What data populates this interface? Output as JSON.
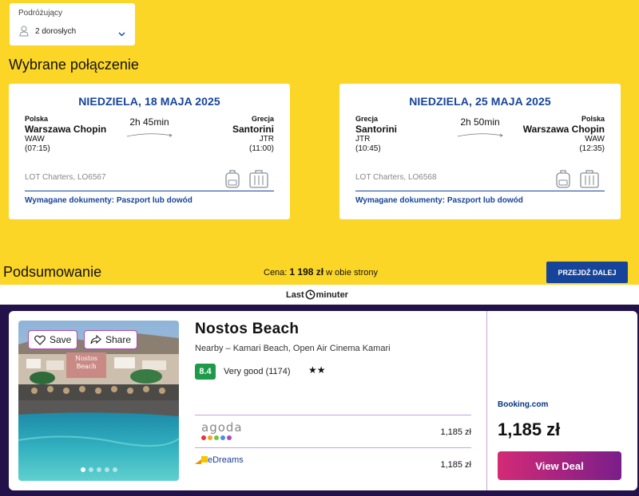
{
  "search": {
    "pax_label": "Podróżujący",
    "pax_value": "2 dorosłych"
  },
  "selected": {
    "title": "Wybrane połączenie",
    "outbound": {
      "date": "NIEDZIELA, 18 MAJA 2025",
      "from_country": "Polska",
      "from_city": "Warszawa Chopin",
      "from_code": "WAW",
      "from_time": "(07:15)",
      "duration": "2h 45min",
      "to_country": "Grecja",
      "to_city": "Santorini",
      "to_code": "JTR",
      "to_time": "(11:00)",
      "carrier": "LOT Charters, LO6567",
      "documents": "Wymagane dokumenty: Paszport lub dowód"
    },
    "inbound": {
      "date": "NIEDZIELA, 25 MAJA 2025",
      "from_country": "Grecja",
      "from_city": "Santorini",
      "from_code": "JTR",
      "from_time": "(10:45)",
      "duration": "2h 50min",
      "to_country": "Polska",
      "to_city": "Warszawa Chopin",
      "to_code": "WAW",
      "to_time": "(12:35)",
      "carrier": "LOT Charters, LO6568",
      "documents": "Wymagane dokumenty: Paszport lub dowód"
    }
  },
  "summary": {
    "title": "Podsumowanie",
    "price_prefix": "Cena: ",
    "price_value": "1 198 zł",
    "price_suffix": " w obie strony",
    "next_label": "PRZEJDŹ DALEJ"
  },
  "brand": {
    "left": "Last",
    "right": "minuter"
  },
  "hotel": {
    "save_label": "Save",
    "share_label": "Share",
    "photo_sign": "Nostos Beach",
    "name": "Nostos Beach",
    "nearby": "Nearby – Kamari Beach, Open Air Cinema Kamari",
    "rating_score": "8.4",
    "rating_text": "Very good (1174)",
    "stars": "★★",
    "providers": [
      {
        "name": "agoda",
        "price": "1,185 zł"
      },
      {
        "name": "eDreams",
        "price": "1,185 zł"
      }
    ],
    "featured_provider": "Booking.com",
    "featured_price": "1,185 zł",
    "view_deal_label": "View Deal"
  },
  "colors": {
    "page_yellow": "#fcd626",
    "lot_blue": "#16449a",
    "deal_bg": "#23124a",
    "rating_green": "#1f9a4b",
    "deal_button_start": "#d42a76",
    "deal_button_end": "#7a1e8a",
    "agoda_dots": [
      "#e8343f",
      "#f5a623",
      "#7ac143",
      "#4a90e2",
      "#a64ac9"
    ]
  },
  "icons": {
    "pax": "person-icon",
    "dropdown": "chevron-down-icon",
    "cabin_bag": "backpack-icon",
    "checked_bag": "suitcase-icon",
    "save": "heart-icon",
    "share": "share-icon",
    "brand": "clock-icon"
  }
}
